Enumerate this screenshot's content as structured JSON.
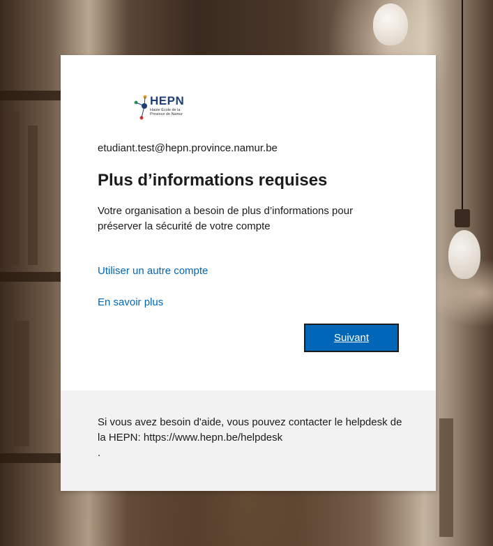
{
  "logo": {
    "name": "HEPN",
    "subtitle": "Haute École de la Province de Namur"
  },
  "signin": {
    "email": "etudiant.test@hepn.province.namur.be",
    "title": "Plus d’informations requises",
    "description": "Votre organisation a besoin de plus d’informations pour préserver la sécurité de votre compte",
    "use_other_account": "Utiliser un autre compte",
    "learn_more": "En savoir plus",
    "next_label": "Suivant"
  },
  "footer": {
    "help_text": "Si vous avez besoin d'aide, vous pouvez contacter le helpdesk de la HEPN: https://www.hepn.be/helpdesk",
    "trailing": "."
  },
  "colors": {
    "accent": "#0067b8",
    "footer_bg": "#f2f2f2",
    "logo_blue": "#1f3f7a"
  }
}
